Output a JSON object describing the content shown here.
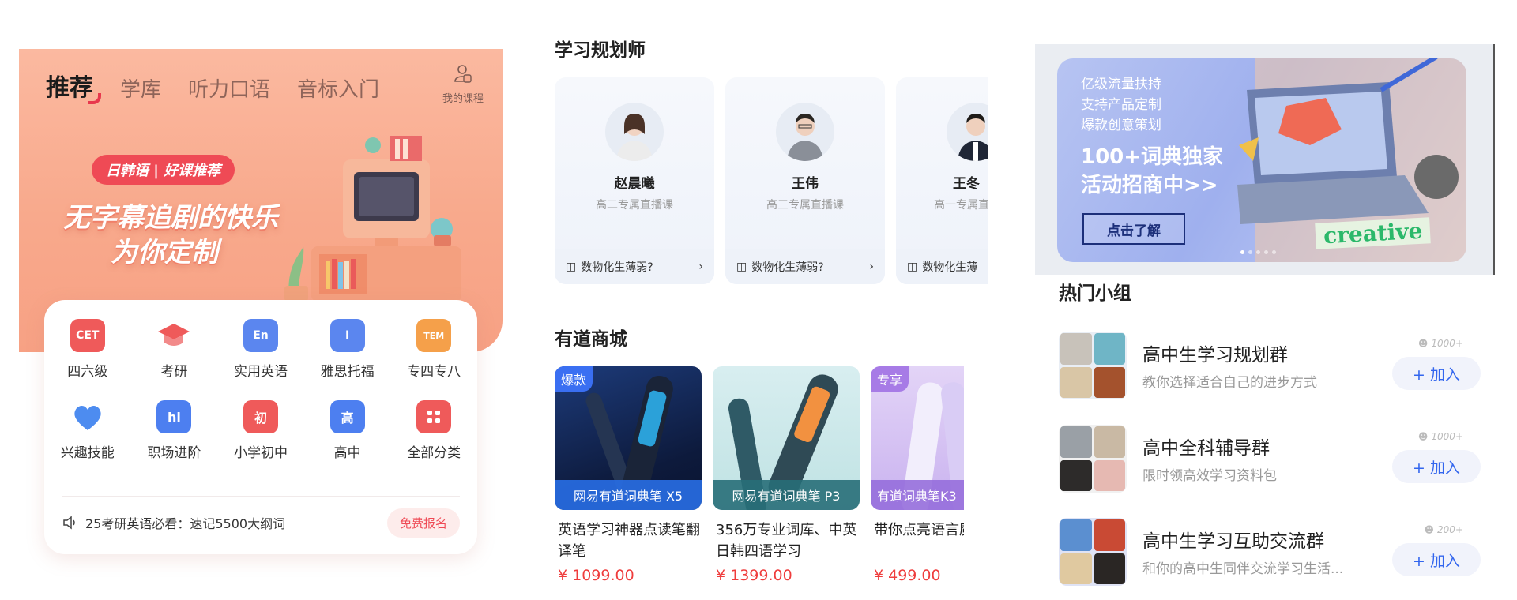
{
  "home": {
    "tabs": [
      {
        "label": "推荐",
        "active": true
      },
      {
        "label": "学库",
        "active": false
      },
      {
        "label": "听力口语",
        "active": false
      },
      {
        "label": "音标入门",
        "active": false
      }
    ],
    "my_course_label": "我的课程",
    "promo": {
      "tag": "日韩语 | 好课推荐",
      "line1": "无字幕追剧的快乐",
      "line2": "为你定制"
    },
    "categories": [
      {
        "label": "四六级",
        "icon": "CET",
        "color": "#ef5a5a"
      },
      {
        "label": "考研",
        "icon": "graduation-cap-icon",
        "color": "#ef5a5a"
      },
      {
        "label": "实用英语",
        "icon": "En",
        "color": "#5b86ef"
      },
      {
        "label": "雅思托福",
        "icon": "I",
        "color": "#5b86ef"
      },
      {
        "label": "专四专八",
        "icon": "TEM",
        "color": "#f5a04a"
      },
      {
        "label": "兴趣技能",
        "icon": "heart-icon",
        "color": "#4d8cf0"
      },
      {
        "label": "职场进阶",
        "icon": "hi",
        "color": "#4d7ff0"
      },
      {
        "label": "小学初中",
        "icon": "初",
        "color": "#ef5a5a"
      },
      {
        "label": "高中",
        "icon": "高",
        "color": "#4d7ff0"
      },
      {
        "label": "全部分类",
        "icon": "grid-icon",
        "color": "#ef5a5a"
      }
    ],
    "notice": "25考研英语必看：速记5500大纲词",
    "notice_button": "免费报名"
  },
  "planners": {
    "title": "学习规划师",
    "items": [
      {
        "name": "赵晨曦",
        "desc": "高二专属直播课",
        "question": "数物化生薄弱?"
      },
      {
        "name": "王伟",
        "desc": "高三专属直播课",
        "question": "数物化生薄弱?"
      },
      {
        "name": "王冬",
        "desc": "高一专属直",
        "question": "数物化生薄"
      }
    ]
  },
  "shop": {
    "title": "有道商城",
    "products": [
      {
        "badge": "爆款",
        "strip": "网易有道词典笔 X5",
        "title": "英语学习神器点读笔翻译笔",
        "price": "¥ 1099.00"
      },
      {
        "badge": "",
        "strip": "网易有道词典笔 P3",
        "title": "356万专业词库、中英日韩四语学习",
        "price": "¥ 1399.00"
      },
      {
        "badge": "专享",
        "strip": "有道词典笔K3",
        "title": "带你点亮语言魔法世界",
        "price": "¥ 499.00"
      }
    ]
  },
  "banner": {
    "small": [
      "亿级流量扶持",
      "支持产品定制",
      "爆款创意策划"
    ],
    "big": [
      "100+词典独家",
      "活动招商中>>"
    ],
    "cta": "点击了解",
    "creative": "creative",
    "dots": 5,
    "active_dot": 0
  },
  "groups": {
    "title": "热门小组",
    "items": [
      {
        "name": "高中生学习规划群",
        "desc": "教你选择适合自己的进步方式",
        "count": "1000+",
        "join": "+ 加入"
      },
      {
        "name": "高中全科辅导群",
        "desc": "限时领高效学习资料包",
        "count": "1000+",
        "join": "+ 加入"
      },
      {
        "name": "高中生学习互助交流群",
        "desc": "和你的高中生同伴交流学习生活...",
        "count": "200+",
        "join": "+ 加入"
      }
    ]
  }
}
